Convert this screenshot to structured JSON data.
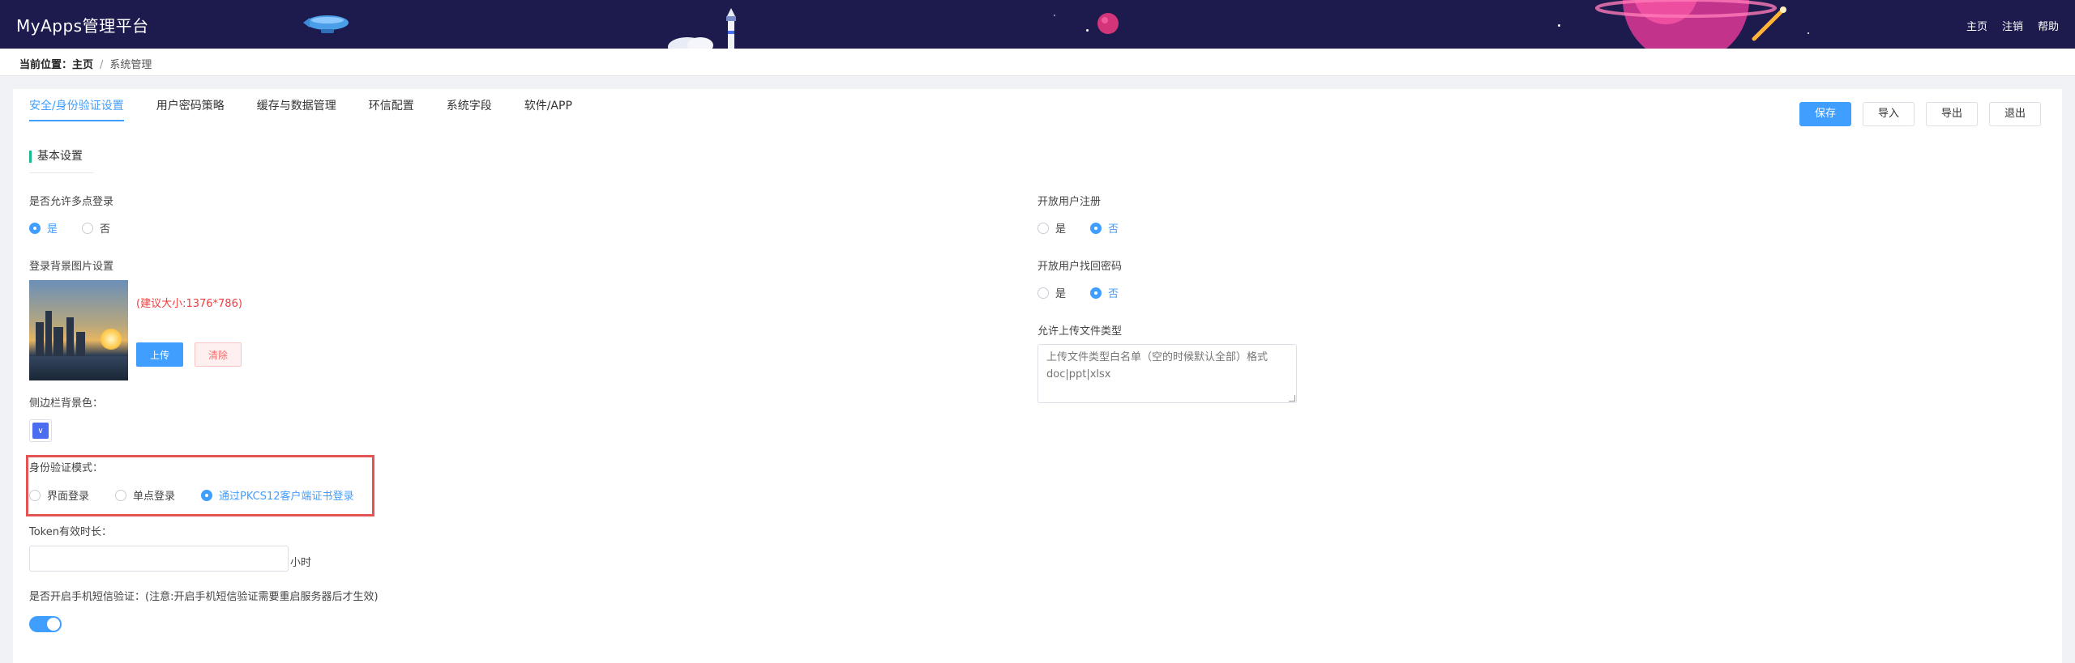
{
  "app": {
    "title": "MyApps管理平台"
  },
  "header_nav": [
    "主页",
    "注销",
    "帮助"
  ],
  "breadcrumb": {
    "prefix": "当前位置：",
    "home": "主页",
    "separator": "/",
    "current": "系统管理"
  },
  "tabs": [
    {
      "label": "安全/身份验证设置",
      "active": true
    },
    {
      "label": "用户密码策略",
      "active": false
    },
    {
      "label": "缓存与数据管理",
      "active": false
    },
    {
      "label": "环信配置",
      "active": false
    },
    {
      "label": "系统字段",
      "active": false
    },
    {
      "label": "软件/APP",
      "active": false
    }
  ],
  "actions": {
    "save": "保存",
    "import": "导入",
    "export": "导出",
    "exit": "退出"
  },
  "section": {
    "title": "基本设置"
  },
  "left": {
    "multi_login": {
      "label": "是否允许多点登录",
      "options": [
        "是",
        "否"
      ],
      "selected": "是"
    },
    "bg_image": {
      "label": "登录背景图片设置",
      "hint": "(建议大小:1376*786)",
      "upload": "上传",
      "clear": "清除"
    },
    "sidebar_color": {
      "label": "侧边栏背景色：",
      "value": "#4a6cf0"
    },
    "auth_mode": {
      "label": "身份验证模式：",
      "options": [
        "界面登录",
        "单点登录",
        "通过PKCS12客户端证书登录"
      ],
      "selected": "通过PKCS12客户端证书登录"
    },
    "token": {
      "label": "Token有效时长：",
      "value": "",
      "unit": "小时"
    },
    "sms": {
      "label": "是否开启手机短信验证：(注意:开启手机短信验证需要重启服务器后才生效)",
      "enabled": true
    }
  },
  "right": {
    "open_register": {
      "label": "开放用户注册",
      "options": [
        "是",
        "否"
      ],
      "selected": "否"
    },
    "open_recover": {
      "label": "开放用户找回密码",
      "options": [
        "是",
        "否"
      ],
      "selected": "否"
    },
    "upload_types": {
      "label": "允许上传文件类型",
      "placeholder": "上传文件类型白名单（空的时候默认全部）格式doc|ppt|xlsx"
    }
  },
  "colors": {
    "header_bg": "#1d1a4d",
    "accent": "#409eff",
    "danger": "#f03c3c",
    "section_mark": "#1cb88f",
    "highlight_border": "#e55353"
  }
}
